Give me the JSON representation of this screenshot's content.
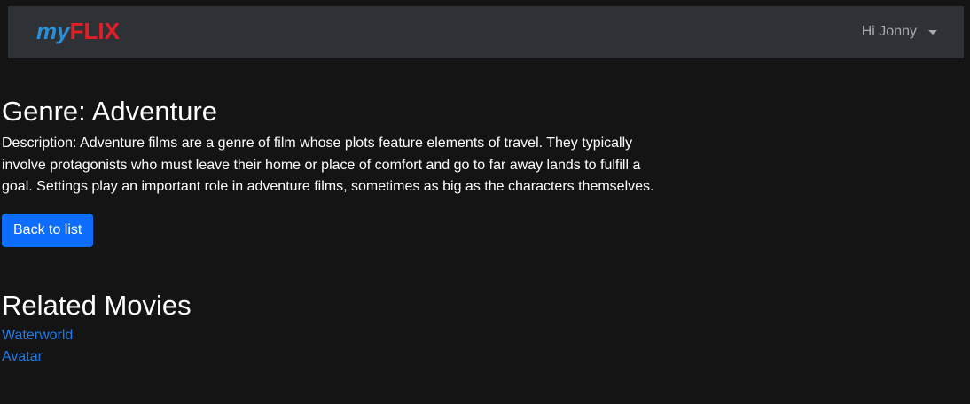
{
  "navbar": {
    "brand_my": "my",
    "brand_flix": "FLIX",
    "user_greeting": "Hi Jonny"
  },
  "genre": {
    "title": "Genre: Adventure",
    "description": "Description: Adventure films are a genre of film whose plots feature elements of travel. They typically involve protagonists who must leave their home or place of comfort and go to far away lands to fulfill a goal. Settings play an important role in adventure films, sometimes as big as the characters themselves.",
    "back_label": "Back to list"
  },
  "related": {
    "heading": "Related Movies",
    "movies": [
      {
        "title": "Waterworld"
      },
      {
        "title": "Avatar"
      }
    ]
  },
  "colors": {
    "background": "#141414",
    "navbar": "#2e3236",
    "brand_blue": "#2a8fd6",
    "brand_red": "#e31e24",
    "button": "#0d6efd",
    "link": "#1f7bea"
  }
}
